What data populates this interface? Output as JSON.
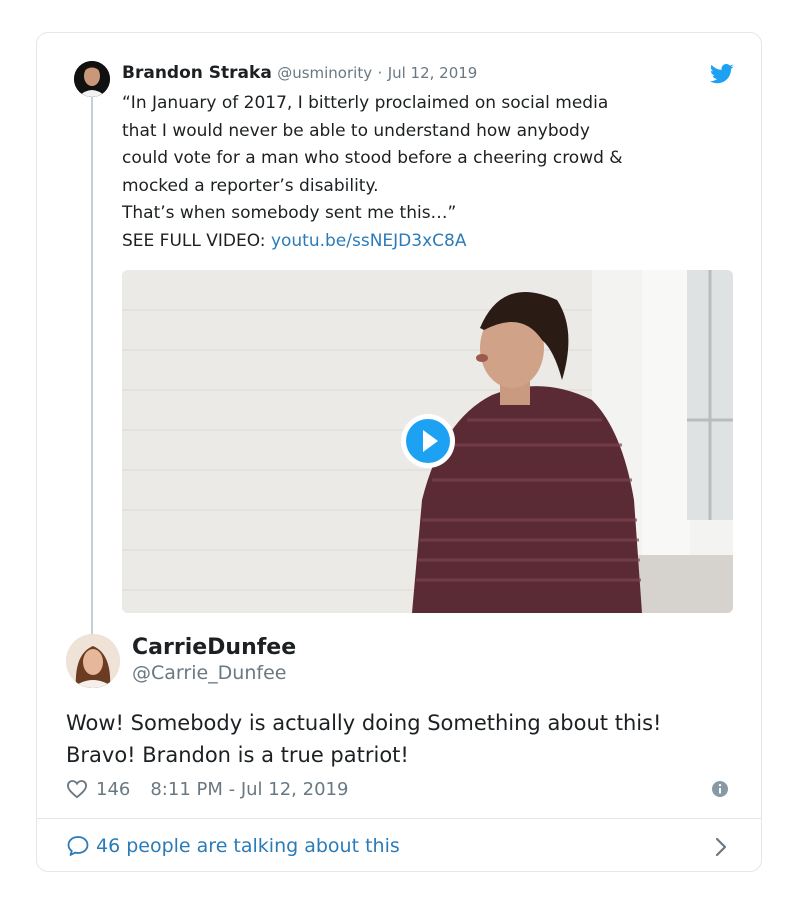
{
  "quoted_tweet": {
    "author_name": "Brandon Straka",
    "handle": "@usminority",
    "separator": "·",
    "date": "Jul 12, 2019",
    "text_lines": [
      "“In January of 2017, I bitterly proclaimed on social media",
      "that I would never be able to understand how anybody",
      "could vote for a man who stood before a cheering crowd &",
      "mocked a reporter’s disability.",
      "That’s when somebody sent me this…”"
    ],
    "video_prefix": "SEE FULL VIDEO: ",
    "video_link": "youtu.be/ssNEJD3xC8A"
  },
  "reply": {
    "author_name": "CarrieDunfee",
    "handle": "@Carrie_Dunfee",
    "text_lines": [
      "Wow! Somebody is actually doing Something about this!",
      "Bravo! Brandon is a true patriot!"
    ],
    "likes": "146",
    "timestamp": "8:11 PM - Jul 12, 2019"
  },
  "footer": {
    "talking_label": "46 people are talking about this"
  },
  "icons": {
    "brand": "twitter-bird-icon",
    "play": "play-icon",
    "like": "heart-icon",
    "info": "info-icon",
    "conversation": "speech-bubble-icon",
    "more": "chevron-right-icon"
  },
  "colors": {
    "twitter_blue": "#1da1f2",
    "link_blue": "#2b7bb9",
    "muted_gray": "#697882",
    "border": "#e1e8ed"
  }
}
